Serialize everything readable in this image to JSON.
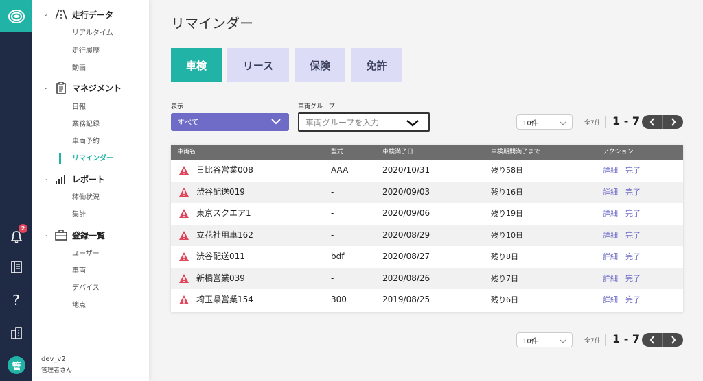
{
  "rail": {
    "notification_count": "2",
    "avatar_text": "管"
  },
  "sidebar": {
    "sections": [
      {
        "title": "走行データ",
        "items": [
          "リアルタイム",
          "走行履歴",
          "動画"
        ]
      },
      {
        "title": "マネジメント",
        "items": [
          "日報",
          "業務記録",
          "車両予約",
          "リマインダー"
        ]
      },
      {
        "title": "レポート",
        "items": [
          "稼働状況",
          "集計"
        ]
      },
      {
        "title": "登録一覧",
        "items": [
          "ユーザー",
          "車両",
          "デバイス",
          "地点"
        ]
      }
    ],
    "user_name": "dev_v2",
    "user_role": "管理者さん"
  },
  "page": {
    "title": "リマインダー",
    "tabs": [
      "車検",
      "リース",
      "保険",
      "免許"
    ],
    "active_tab": "車検"
  },
  "filters": {
    "display_label": "表示",
    "display_value": "すべて",
    "group_label": "車両グループ",
    "group_placeholder": "車両グループを入力"
  },
  "pagination": {
    "per_page": "10件",
    "total": "全7件",
    "range": "1 - 7"
  },
  "table": {
    "headers": [
      "車両名",
      "型式",
      "車検満了日",
      "車検期間満了まで",
      "アクション"
    ],
    "rows": [
      {
        "name": "日比谷営業008",
        "model": "AAA",
        "date": "2020/10/31",
        "remaining": "残り58日"
      },
      {
        "name": "渋谷配送019",
        "model": "-",
        "date": "2020/09/03",
        "remaining": "残り16日"
      },
      {
        "name": "東京スクエア1",
        "model": "-",
        "date": "2020/09/06",
        "remaining": "残り19日"
      },
      {
        "name": "立花社用車162",
        "model": "-",
        "date": "2020/08/29",
        "remaining": "残り10日"
      },
      {
        "name": "渋谷配送011",
        "model": "bdf",
        "date": "2020/08/27",
        "remaining": "残り8日"
      },
      {
        "name": "新橋営業039",
        "model": "-",
        "date": "2020/08/26",
        "remaining": "残り7日"
      },
      {
        "name": "埼玉県営業154",
        "model": "300",
        "date": "2019/08/25",
        "remaining": "残り6日"
      }
    ],
    "action_detail": "詳細",
    "action_complete": "完了"
  },
  "colors": {
    "accent": "#21b3a6",
    "purple": "#6e6cc7",
    "rail": "#1f2a44",
    "warning": "#e0445a"
  }
}
